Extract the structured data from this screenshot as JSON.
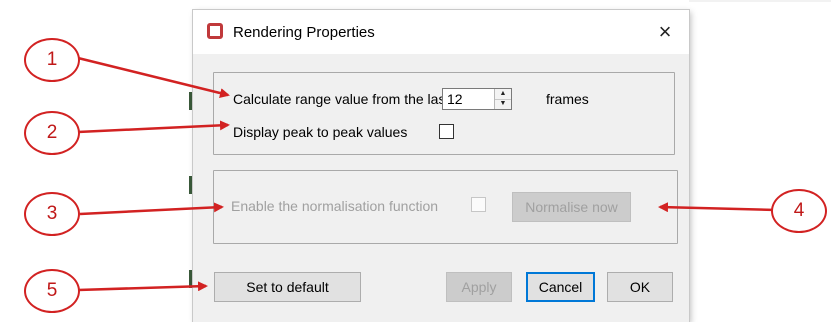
{
  "dialog": {
    "title": "Rendering Properties",
    "close_glyph": "×",
    "icon": "window-icon",
    "range": {
      "label_before": "Calculate range value from the last",
      "frames_value": "12",
      "label_after": "frames"
    },
    "peak": {
      "label": "Display peak to peak values",
      "checked": false
    },
    "normalisation": {
      "label": "Enable the normalisation function",
      "checked": false,
      "enabled": false,
      "normalise_button": "Normalise now"
    },
    "buttons": {
      "set_default": "Set to default",
      "apply": "Apply",
      "cancel": "Cancel",
      "ok": "OK"
    }
  },
  "callouts": [
    "1",
    "2",
    "3",
    "4",
    "5"
  ],
  "colors": {
    "annotation": "#d22222",
    "focus": "#0078d7",
    "disabled_text": "#a0a0a0"
  }
}
